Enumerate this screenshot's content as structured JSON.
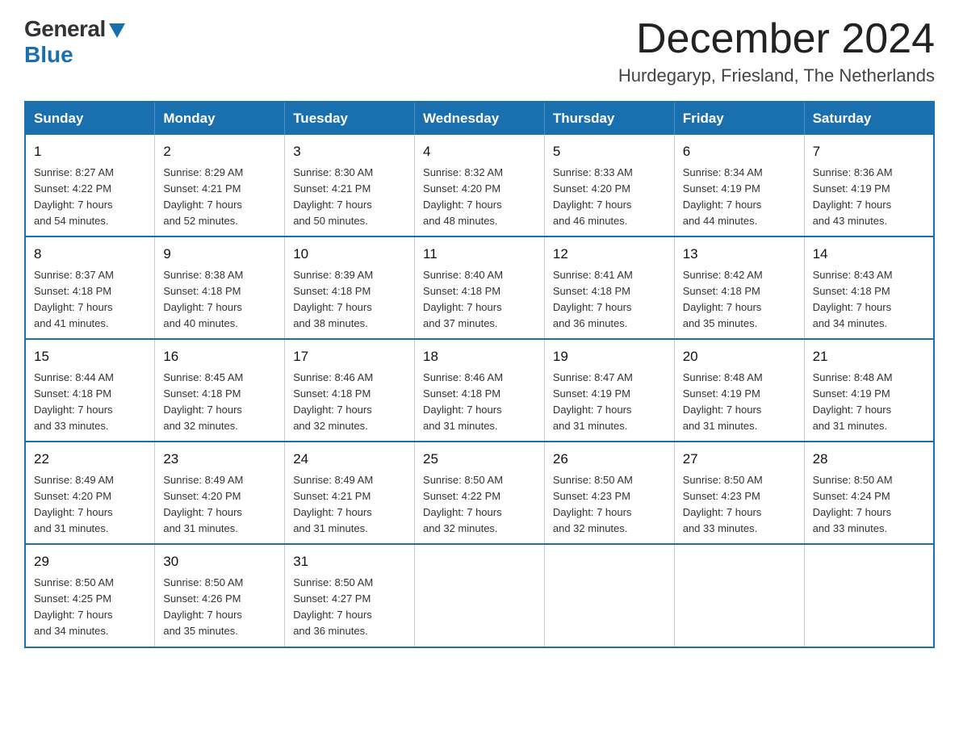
{
  "header": {
    "logo_general": "General",
    "logo_blue": "Blue",
    "month_year": "December 2024",
    "location": "Hurdegaryp, Friesland, The Netherlands"
  },
  "weekdays": [
    "Sunday",
    "Monday",
    "Tuesday",
    "Wednesday",
    "Thursday",
    "Friday",
    "Saturday"
  ],
  "weeks": [
    [
      {
        "day": "1",
        "sunrise": "8:27 AM",
        "sunset": "4:22 PM",
        "daylight": "7 hours and 54 minutes."
      },
      {
        "day": "2",
        "sunrise": "8:29 AM",
        "sunset": "4:21 PM",
        "daylight": "7 hours and 52 minutes."
      },
      {
        "day": "3",
        "sunrise": "8:30 AM",
        "sunset": "4:21 PM",
        "daylight": "7 hours and 50 minutes."
      },
      {
        "day": "4",
        "sunrise": "8:32 AM",
        "sunset": "4:20 PM",
        "daylight": "7 hours and 48 minutes."
      },
      {
        "day": "5",
        "sunrise": "8:33 AM",
        "sunset": "4:20 PM",
        "daylight": "7 hours and 46 minutes."
      },
      {
        "day": "6",
        "sunrise": "8:34 AM",
        "sunset": "4:19 PM",
        "daylight": "7 hours and 44 minutes."
      },
      {
        "day": "7",
        "sunrise": "8:36 AM",
        "sunset": "4:19 PM",
        "daylight": "7 hours and 43 minutes."
      }
    ],
    [
      {
        "day": "8",
        "sunrise": "8:37 AM",
        "sunset": "4:18 PM",
        "daylight": "7 hours and 41 minutes."
      },
      {
        "day": "9",
        "sunrise": "8:38 AM",
        "sunset": "4:18 PM",
        "daylight": "7 hours and 40 minutes."
      },
      {
        "day": "10",
        "sunrise": "8:39 AM",
        "sunset": "4:18 PM",
        "daylight": "7 hours and 38 minutes."
      },
      {
        "day": "11",
        "sunrise": "8:40 AM",
        "sunset": "4:18 PM",
        "daylight": "7 hours and 37 minutes."
      },
      {
        "day": "12",
        "sunrise": "8:41 AM",
        "sunset": "4:18 PM",
        "daylight": "7 hours and 36 minutes."
      },
      {
        "day": "13",
        "sunrise": "8:42 AM",
        "sunset": "4:18 PM",
        "daylight": "7 hours and 35 minutes."
      },
      {
        "day": "14",
        "sunrise": "8:43 AM",
        "sunset": "4:18 PM",
        "daylight": "7 hours and 34 minutes."
      }
    ],
    [
      {
        "day": "15",
        "sunrise": "8:44 AM",
        "sunset": "4:18 PM",
        "daylight": "7 hours and 33 minutes."
      },
      {
        "day": "16",
        "sunrise": "8:45 AM",
        "sunset": "4:18 PM",
        "daylight": "7 hours and 32 minutes."
      },
      {
        "day": "17",
        "sunrise": "8:46 AM",
        "sunset": "4:18 PM",
        "daylight": "7 hours and 32 minutes."
      },
      {
        "day": "18",
        "sunrise": "8:46 AM",
        "sunset": "4:18 PM",
        "daylight": "7 hours and 31 minutes."
      },
      {
        "day": "19",
        "sunrise": "8:47 AM",
        "sunset": "4:19 PM",
        "daylight": "7 hours and 31 minutes."
      },
      {
        "day": "20",
        "sunrise": "8:48 AM",
        "sunset": "4:19 PM",
        "daylight": "7 hours and 31 minutes."
      },
      {
        "day": "21",
        "sunrise": "8:48 AM",
        "sunset": "4:19 PM",
        "daylight": "7 hours and 31 minutes."
      }
    ],
    [
      {
        "day": "22",
        "sunrise": "8:49 AM",
        "sunset": "4:20 PM",
        "daylight": "7 hours and 31 minutes."
      },
      {
        "day": "23",
        "sunrise": "8:49 AM",
        "sunset": "4:20 PM",
        "daylight": "7 hours and 31 minutes."
      },
      {
        "day": "24",
        "sunrise": "8:49 AM",
        "sunset": "4:21 PM",
        "daylight": "7 hours and 31 minutes."
      },
      {
        "day": "25",
        "sunrise": "8:50 AM",
        "sunset": "4:22 PM",
        "daylight": "7 hours and 32 minutes."
      },
      {
        "day": "26",
        "sunrise": "8:50 AM",
        "sunset": "4:23 PM",
        "daylight": "7 hours and 32 minutes."
      },
      {
        "day": "27",
        "sunrise": "8:50 AM",
        "sunset": "4:23 PM",
        "daylight": "7 hours and 33 minutes."
      },
      {
        "day": "28",
        "sunrise": "8:50 AM",
        "sunset": "4:24 PM",
        "daylight": "7 hours and 33 minutes."
      }
    ],
    [
      {
        "day": "29",
        "sunrise": "8:50 AM",
        "sunset": "4:25 PM",
        "daylight": "7 hours and 34 minutes."
      },
      {
        "day": "30",
        "sunrise": "8:50 AM",
        "sunset": "4:26 PM",
        "daylight": "7 hours and 35 minutes."
      },
      {
        "day": "31",
        "sunrise": "8:50 AM",
        "sunset": "4:27 PM",
        "daylight": "7 hours and 36 minutes."
      },
      null,
      null,
      null,
      null
    ]
  ],
  "labels": {
    "sunrise_prefix": "Sunrise: ",
    "sunset_prefix": "Sunset: ",
    "daylight_prefix": "Daylight: "
  }
}
